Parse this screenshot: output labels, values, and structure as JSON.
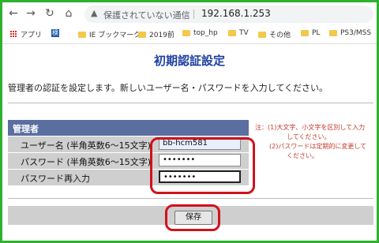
{
  "browser": {
    "security_label": "保護されていない通信",
    "url": "192.168.1.253"
  },
  "bookmarks": [
    {
      "label": "アプリ",
      "icon": "apps-icon"
    },
    {
      "label": "検",
      "icon": "kanji-icon"
    },
    {
      "label": "IE ブックマーク",
      "icon": "folder-icon"
    },
    {
      "label": "2019前",
      "icon": "folder-icon"
    },
    {
      "label": "top_hp",
      "icon": "folder-icon"
    },
    {
      "label": "TV",
      "icon": "folder-icon"
    },
    {
      "label": "その他",
      "icon": "folder-icon"
    },
    {
      "label": "PL",
      "icon": "folder-icon"
    },
    {
      "label": "PS3/MSS",
      "icon": "folder-icon"
    }
  ],
  "page": {
    "title": "初期認証設定",
    "description": "管理者の認証を設定します。新しいユーザー名・パスワードを入力してください。",
    "section_header": "管理者",
    "fields": {
      "username_label": "ユーザー名 (半角英数6～15文字)",
      "username_value": "bb-hcm581",
      "password_label": "パスワード (半角英数6～15文字)",
      "password_value": "•••••••",
      "password_confirm_label": "パスワード再入力",
      "password_confirm_value": "•••••••"
    },
    "note_line1": "注：(1)大文字、小文字を区別して入力",
    "note_line2": "してください。",
    "note_line3": "(2)パスワードは定期的に変更して",
    "note_line4": "ください。",
    "save_label": "保存"
  },
  "colors": {
    "title": "#1e3fa0",
    "header_bg": "#5a6fa0",
    "highlight": "#d0121b",
    "note": "#c0392b",
    "frame": "#2fb12f"
  }
}
